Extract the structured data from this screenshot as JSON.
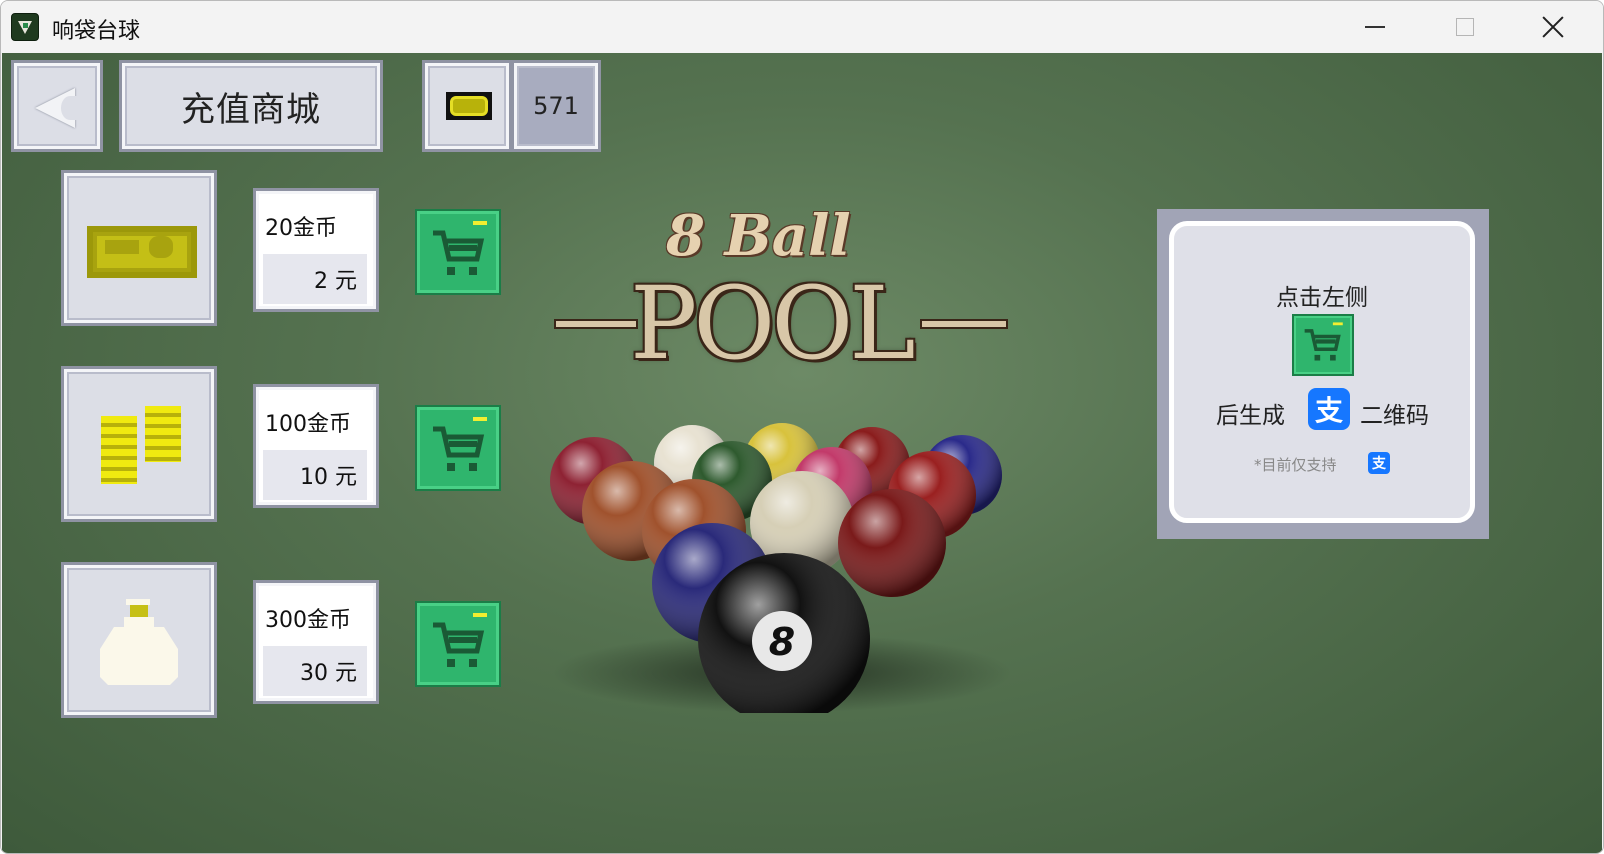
{
  "window": {
    "title": "响袋台球",
    "controls": {
      "minimize": "minimize-icon",
      "maximize": "maximize-icon",
      "close": "close-icon"
    }
  },
  "header": {
    "back_icon": "back-arrow-icon",
    "title": "充值商城",
    "currency_icon": "banknote-icon",
    "coin_balance": "571"
  },
  "items": [
    {
      "coins": "20金币",
      "price": "2 元",
      "icon": "banknote-icon",
      "cart_icon": "shopping-cart-icon"
    },
    {
      "coins": "100金币",
      "price": "10 元",
      "icon": "coin-stacks-icon",
      "cart_icon": "shopping-cart-icon"
    },
    {
      "coins": "300金币",
      "price": "30 元",
      "icon": "money-bag-icon",
      "cart_icon": "shopping-cart-icon"
    }
  ],
  "logo": {
    "line1": "8 Ball",
    "line2": "POOL"
  },
  "info_panel": {
    "line1": "点击左侧",
    "line2_prefix": "后生成",
    "line2_suffix": "二维码",
    "payment_glyph": "支",
    "note": "*目前仅支持",
    "payment_icon": "alipay-icon"
  },
  "colors": {
    "felt": "#557250",
    "panel": "#dcdee6",
    "cart_button": "#2fb56d",
    "alipay": "#1677ff"
  }
}
